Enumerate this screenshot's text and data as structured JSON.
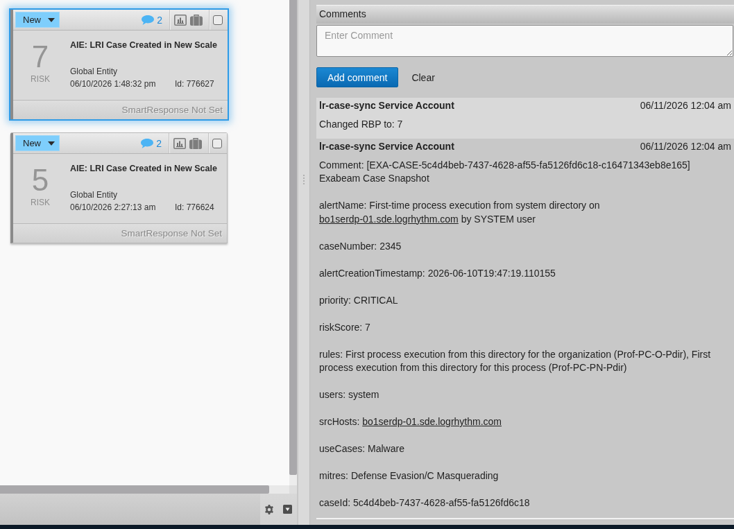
{
  "case_list": {
    "cards": [
      {
        "selected": true,
        "status": "New",
        "comment_count": "2",
        "checked": false,
        "risk": "7",
        "risk_label": "RISK",
        "title": "AIE: LRI Case Created in New Scale",
        "entity": "Global Entity",
        "date": "06/10/2026 1:48:32 pm",
        "id": "Id: 776627",
        "smart_response": "SmartResponse Not Set"
      },
      {
        "selected": false,
        "status": "New",
        "comment_count": "2",
        "checked": false,
        "risk": "5",
        "risk_label": "RISK",
        "title": "AIE: LRI Case Created in New Scale",
        "entity": "Global Entity",
        "date": "06/10/2026 2:27:13 am",
        "id": "Id: 776624",
        "smart_response": "SmartResponse Not Set"
      }
    ]
  },
  "comments_panel": {
    "header": "Comments",
    "comment_field": {
      "placeholder": "Enter Comment"
    },
    "buttons": [
      {
        "label": "Add comment",
        "kind": "primary"
      },
      {
        "label": "Clear",
        "kind": "plain"
      }
    ],
    "comments": [
      {
        "author": "lr-case-sync Service Account",
        "date": "06/11/2026 12:04 am",
        "paragraphs": [
          [
            {
              "kind": "text",
              "text": "Changed RBP to: 7"
            }
          ]
        ]
      },
      {
        "author": "lr-case-sync Service Account",
        "date": "06/11/2026 12:04 am",
        "paragraphs": [
          [
            {
              "kind": "text",
              "text": "Comment: [EXA-CASE-5c4d4beb-7437-4628-af55-fa5126fd6c18-c16471343eb8e165]"
            },
            {
              "kind": "break"
            },
            {
              "kind": "text",
              "text": "Exabeam Case Snapshot"
            }
          ],
          [
            {
              "kind": "text",
              "text": "alertName: First-time process execution from system directory on "
            },
            {
              "kind": "link",
              "text": "bo1serdp-01.sde.logrhythm.com"
            },
            {
              "kind": "text",
              "text": " by SYSTEM user"
            }
          ],
          [
            {
              "kind": "text",
              "text": "caseNumber: 2345"
            }
          ],
          [
            {
              "kind": "text",
              "text": "alertCreationTimestamp: 2026-06-10T19:47:19.110155"
            }
          ],
          [
            {
              "kind": "text",
              "text": "priority: CRITICAL"
            }
          ],
          [
            {
              "kind": "text",
              "text": "riskScore: 7"
            }
          ],
          [
            {
              "kind": "text",
              "text": "rules: First process execution from this directory for the organization (Prof-PC-O-Pdir), First process execution from this directory for this process (Prof-PC-PN-Pdir)"
            }
          ],
          [
            {
              "kind": "text",
              "text": "users: system"
            }
          ],
          [
            {
              "kind": "text",
              "text": "srcHosts: "
            },
            {
              "kind": "link",
              "text": "bo1serdp-01.sde.logrhythm.com"
            }
          ],
          [
            {
              "kind": "text",
              "text": "useCases: Malware"
            }
          ],
          [
            {
              "kind": "text",
              "text": "mitres: Defense Evasion/C Masquerading"
            }
          ],
          [
            {
              "kind": "text",
              "text": "caseId: 5c4d4beb-7437-4628-af55-fa5126fd6c18"
            }
          ]
        ]
      }
    ]
  }
}
